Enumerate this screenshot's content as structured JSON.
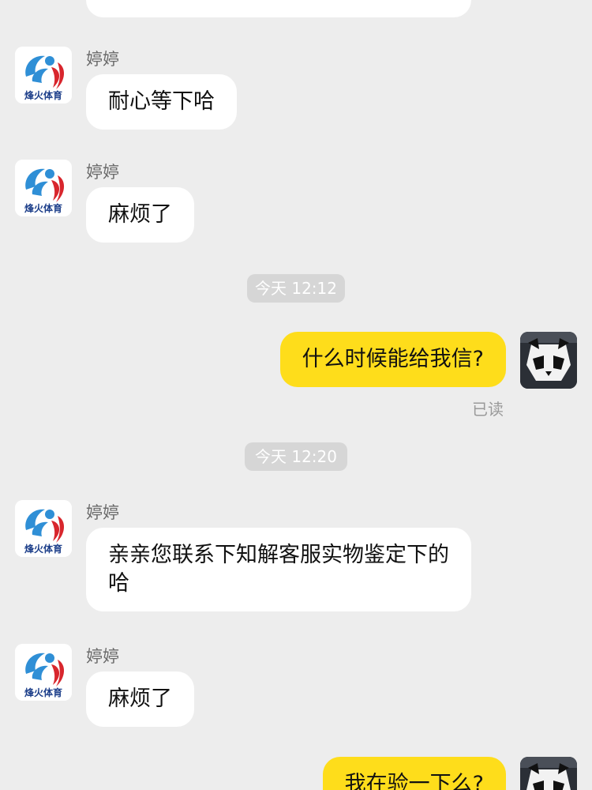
{
  "contact": {
    "name": "婷婷",
    "logo_text": "烽火体育"
  },
  "messages": [
    {
      "text": "耐心等下哈"
    },
    {
      "text": "麻烦了"
    },
    {
      "time": "今天 12:12"
    },
    {
      "text": "什么时候能给我信?",
      "status": "已读"
    },
    {
      "time": "今天 12:20"
    },
    {
      "text": "亲亲您联系下知解客服实物鉴定下的哈"
    },
    {
      "text": "麻烦了"
    },
    {
      "text": "我在验一下么?"
    }
  ],
  "colors": {
    "background": "#ededed",
    "outgoing": "#fedd1b",
    "incoming": "#ffffff",
    "logo_blue": "#2f8fd6",
    "logo_red": "#d8262d"
  }
}
